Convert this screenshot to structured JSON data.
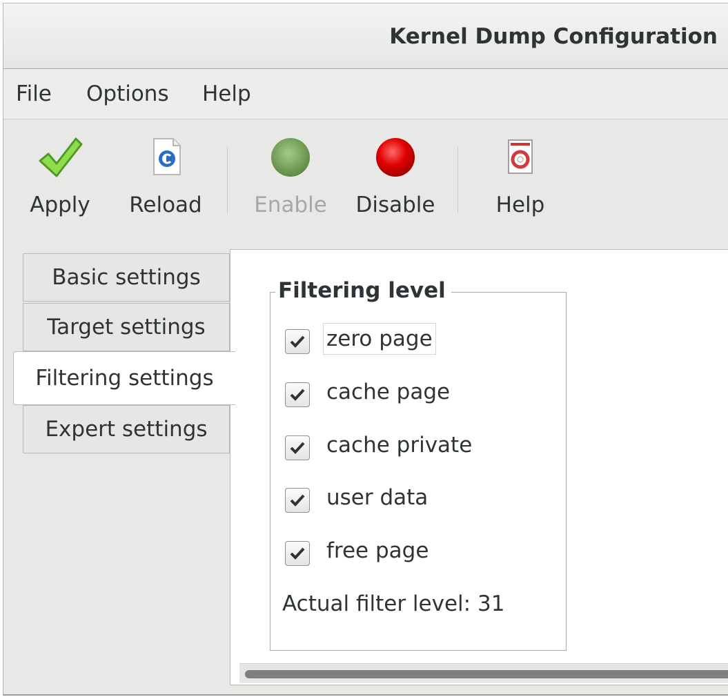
{
  "window": {
    "title": "Kernel Dump Configuration"
  },
  "menubar": {
    "items": [
      {
        "label": "File"
      },
      {
        "label": "Options"
      },
      {
        "label": "Help"
      }
    ]
  },
  "toolbar": {
    "apply": {
      "label": "Apply",
      "icon": "checkmark-icon",
      "enabled": true
    },
    "reload": {
      "label": "Reload",
      "icon": "reload-document-icon",
      "enabled": true
    },
    "enable": {
      "label": "Enable",
      "icon": "green-circle-icon",
      "enabled": false
    },
    "disable": {
      "label": "Disable",
      "icon": "red-circle-icon",
      "enabled": true
    },
    "help": {
      "label": "Help",
      "icon": "lifebuoy-help-icon",
      "enabled": true
    }
  },
  "tabs": [
    {
      "label": "Basic settings",
      "active": false
    },
    {
      "label": "Target settings",
      "active": false
    },
    {
      "label": "Filtering settings",
      "active": true
    },
    {
      "label": "Expert settings",
      "active": false
    }
  ],
  "filtering": {
    "frame_label": "Filtering level",
    "options": [
      {
        "label": "zero page",
        "checked": true
      },
      {
        "label": "cache page",
        "checked": true
      },
      {
        "label": "cache private",
        "checked": true
      },
      {
        "label": "user data",
        "checked": true
      },
      {
        "label": "free page",
        "checked": true
      }
    ],
    "level_label": "Actual filter level:",
    "level_value": "31"
  },
  "colors": {
    "enable_icon": "#6e9a52",
    "disable_icon": "#e00000",
    "apply_check": "#7ccd3c"
  }
}
